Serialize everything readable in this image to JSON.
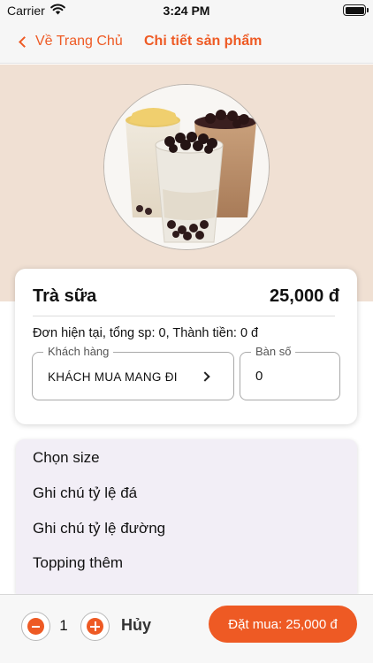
{
  "status_bar": {
    "carrier": "Carrier",
    "time": "3:24 PM"
  },
  "nav": {
    "back_label": "Về Trang Chủ",
    "title": "Chi tiết sản phẩm"
  },
  "product": {
    "name": "Trà sữa",
    "price": "25,000 đ"
  },
  "order": {
    "summary": "Đơn hiện tại, tổng sp: 0, Thành tiền: 0 đ",
    "customer_label": "Khách hàng",
    "customer_value": "KHÁCH MUA MANG ĐI",
    "table_label": "Bàn số",
    "table_value": "0"
  },
  "options": [
    "Chọn size",
    "Ghi chú tỷ lệ đá",
    "Ghi chú tỷ lệ đường",
    "Topping thêm"
  ],
  "bottom": {
    "quantity": "1",
    "cancel_label": "Hủy",
    "order_label": "Đặt mua: 25,000 đ"
  },
  "colors": {
    "accent": "#ee5a24",
    "hero_bg": "#f0e0d3",
    "panel_bg": "#f2eef6"
  },
  "icons": [
    "wifi-icon",
    "battery-icon",
    "chevron-left-icon",
    "chevron-right-icon",
    "minus-icon",
    "plus-icon"
  ]
}
